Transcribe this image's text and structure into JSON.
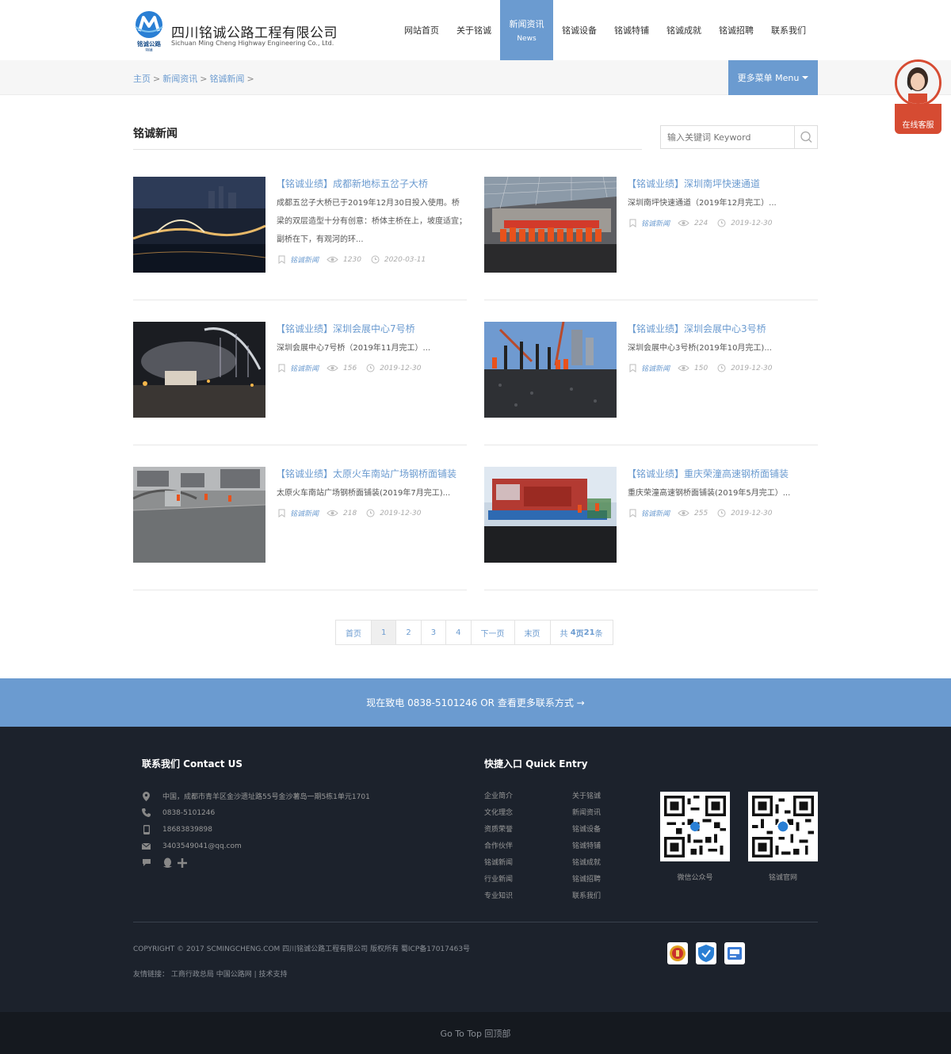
{
  "brand": {
    "name_cn": "四川铭诚公路工程有限公司",
    "name_en": "Sichuan Ming Cheng Highway Engineering Co., Ltd.",
    "logo_text": "铭诚公路",
    "logo_sub": "特铺"
  },
  "nav": {
    "items": [
      {
        "label": "网站首页",
        "sub": ""
      },
      {
        "label": "关于铭诚",
        "sub": ""
      },
      {
        "label": "新闻资讯",
        "sub": "News"
      },
      {
        "label": "铭诚设备",
        "sub": ""
      },
      {
        "label": "铭诚特铺",
        "sub": ""
      },
      {
        "label": "铭诚成就",
        "sub": ""
      },
      {
        "label": "铭诚招聘",
        "sub": ""
      },
      {
        "label": "联系我们",
        "sub": ""
      }
    ]
  },
  "breadcrumb": {
    "items": [
      "主页",
      "新闻资讯",
      "铭诚新闻"
    ],
    "separator": ">",
    "more_menu": "更多菜单 Menu"
  },
  "service": {
    "label": "在线客服"
  },
  "main": {
    "title": "铭诚新闻",
    "search_placeholder": "输入关键词 Keyword"
  },
  "news": [
    {
      "title": "【铭诚业绩】成都新地标五岔子大桥",
      "desc": "成都五岔子大桥已于2019年12月30日投入使用。桥梁的双层造型十分有创意：桥体主桥在上，坡度适宜；副桥在下，有观河的环...",
      "category": "铭诚新闻",
      "views": "1230",
      "date": "2020-03-11"
    },
    {
      "title": "【铭诚业绩】深圳南坪快速通道",
      "desc": "深圳南坪快速通道（2019年12月完工）...",
      "category": "铭诚新闻",
      "views": "224",
      "date": "2019-12-30"
    },
    {
      "title": "【铭诚业绩】深圳会展中心7号桥",
      "desc": "深圳会展中心7号桥（2019年11月完工）...",
      "category": "铭诚新闻",
      "views": "156",
      "date": "2019-12-30"
    },
    {
      "title": "【铭诚业绩】深圳会展中心3号桥",
      "desc": "深圳会展中心3号桥(2019年10月完工)...",
      "category": "铭诚新闻",
      "views": "150",
      "date": "2019-12-30"
    },
    {
      "title": "【铭诚业绩】太原火车南站广场钢桥面铺装",
      "desc": "太原火车南站广场钢桥面铺装(2019年7月完工)...",
      "category": "铭诚新闻",
      "views": "218",
      "date": "2019-12-30"
    },
    {
      "title": "【铭诚业绩】重庆荣潼高速钢桥面铺装",
      "desc": "重庆荣潼高速钢桥面铺装(2019年5月完工）...",
      "category": "铭诚新闻",
      "views": "255",
      "date": "2019-12-30"
    }
  ],
  "pager": {
    "first": "首页",
    "pages": [
      "1",
      "2",
      "3",
      "4"
    ],
    "current": "1",
    "next": "下一页",
    "last": "末页",
    "total_prefix": "共",
    "total_pages": "4",
    "total_mid": "页",
    "total_items": "21",
    "total_suffix": "条"
  },
  "callbar": {
    "text": "现在致电 0838-5101246 OR 查看更多联系方式 →"
  },
  "footer": {
    "contact_title": "联系我们 Contact US",
    "address": "中国，成都市青羊区金沙遗址路55号金沙薯岛一期5栋1单元1701",
    "phone": "0838-5101246",
    "mobile": "18683839898",
    "email": "3403549041@qq.com",
    "quick_title": "快捷入口 Quick Entry",
    "links_left": [
      "企业简介",
      "文化理念",
      "资质荣誉",
      "合作伙伴",
      "铭诚新闻",
      "行业新闻",
      "专业知识"
    ],
    "links_right": [
      "关于铭诚",
      "新闻资讯",
      "铭诚设备",
      "铭诚特铺",
      "铭诚成就",
      "铭诚招聘",
      "联系我们"
    ],
    "qr1_label": "微信公众号",
    "qr2_label": "铭诚官网",
    "copyright": "COPYRIGHT © 2017 SCMINGCHENG.COM 四川铭诚公路工程有限公司 版权所有  蜀ICP备17017463号",
    "friends": "友情链接：  工商行政总局  中国公路网 | 技术支持"
  },
  "gotop": {
    "label": "Go To Top 回顶部"
  },
  "colors": {
    "accent": "#6b9bd0",
    "footer_bg": "#1c222c",
    "service_red": "#d64b32"
  }
}
